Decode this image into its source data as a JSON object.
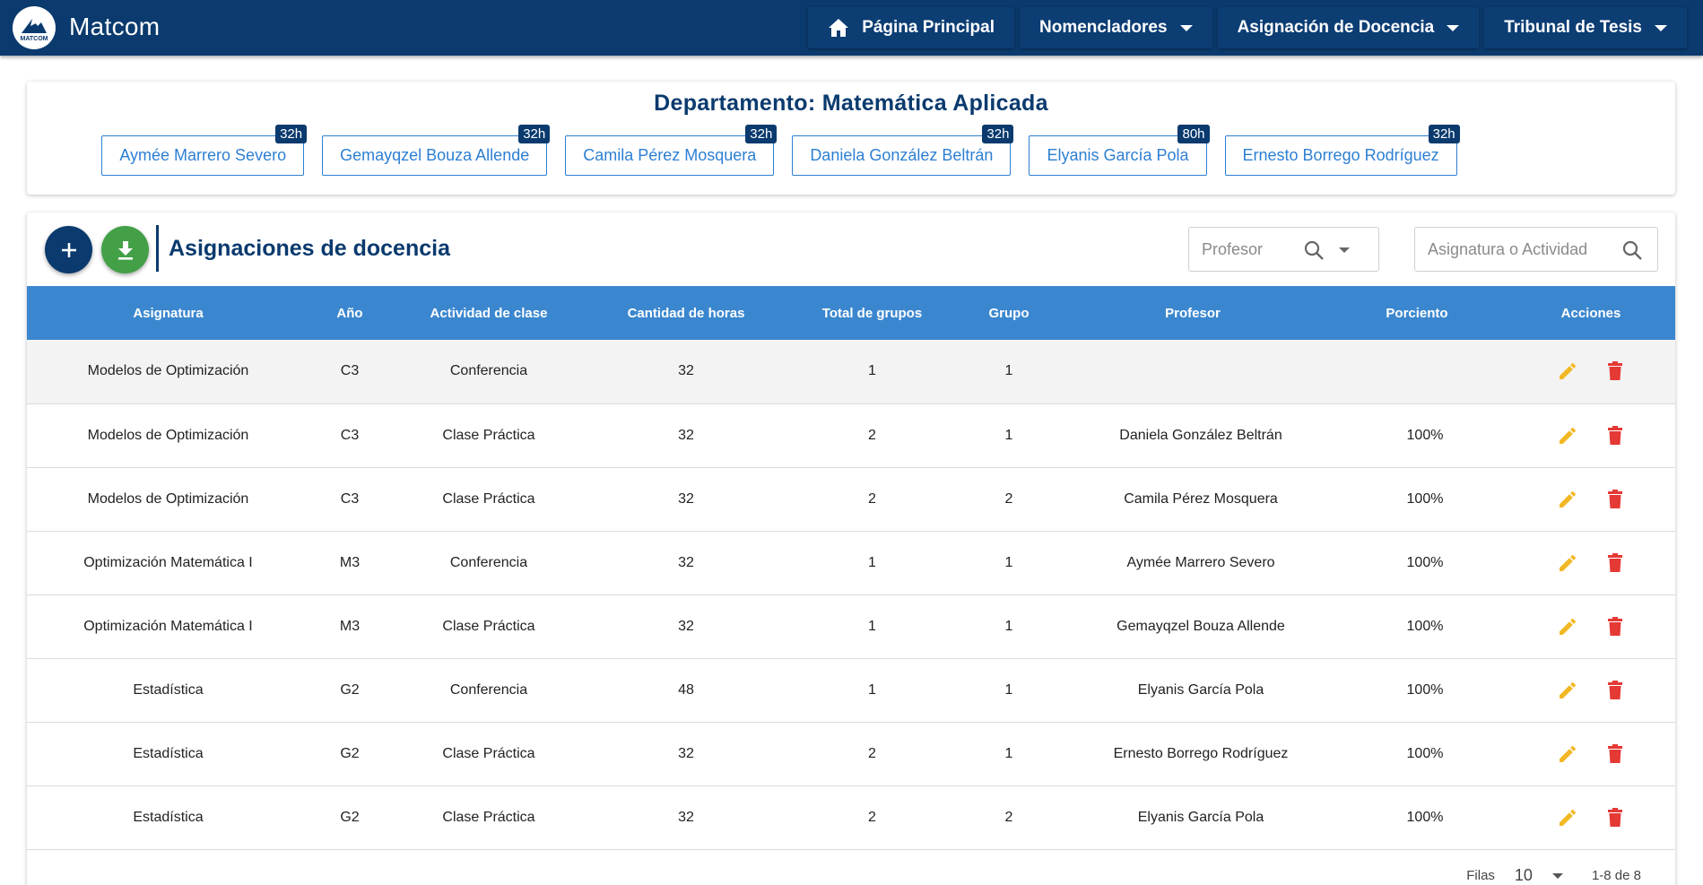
{
  "app": {
    "name": "Matcom",
    "logo_text": "MATCOM"
  },
  "nav": [
    {
      "label": "Página Principal",
      "icon": "home-icon",
      "dropdown": false
    },
    {
      "label": "Nomencladores",
      "dropdown": true
    },
    {
      "label": "Asignación de Docencia",
      "dropdown": true
    },
    {
      "label": "Tribunal de Tesis",
      "dropdown": true
    }
  ],
  "department": {
    "title": "Departamento: Matemática Aplicada",
    "professors": [
      {
        "name": "Aymée Marrero Severo",
        "hours": "32h"
      },
      {
        "name": "Gemayqzel Bouza Allende",
        "hours": "32h"
      },
      {
        "name": "Camila Pérez Mosquera",
        "hours": "32h"
      },
      {
        "name": "Daniela González Beltrán",
        "hours": "32h"
      },
      {
        "name": "Elyanis García Pola",
        "hours": "80h"
      },
      {
        "name": "Ernesto Borrego Rodríguez",
        "hours": "32h"
      }
    ]
  },
  "assignments": {
    "title": "Asignaciones de docencia",
    "filters": {
      "profesor_placeholder": "Profesor",
      "asignatura_placeholder": "Asignatura o Actividad"
    },
    "columns": [
      "Asignatura",
      "Año",
      "Actividad de clase",
      "Cantidad de horas",
      "Total de grupos",
      "Grupo",
      "Profesor",
      "Porciento",
      "Acciones"
    ],
    "rows": [
      [
        "Modelos de Optimización",
        "C3",
        "Conferencia",
        "32",
        "1",
        "1",
        "",
        ""
      ],
      [
        "Modelos de Optimización",
        "C3",
        "Clase Práctica",
        "32",
        "2",
        "1",
        "Daniela González Beltrán",
        "100%"
      ],
      [
        "Modelos de Optimización",
        "C3",
        "Clase Práctica",
        "32",
        "2",
        "2",
        "Camila Pérez Mosquera",
        "100%"
      ],
      [
        "Optimización Matemática I",
        "M3",
        "Conferencia",
        "32",
        "1",
        "1",
        "Aymée Marrero Severo",
        "100%"
      ],
      [
        "Optimización Matemática I",
        "M3",
        "Clase Práctica",
        "32",
        "1",
        "1",
        "Gemayqzel Bouza Allende",
        "100%"
      ],
      [
        "Estadística",
        "G2",
        "Conferencia",
        "48",
        "1",
        "1",
        "Elyanis García Pola",
        "100%"
      ],
      [
        "Estadística",
        "G2",
        "Clase Práctica",
        "32",
        "2",
        "1",
        "Ernesto Borrego Rodríguez",
        "100%"
      ],
      [
        "Estadística",
        "G2",
        "Clase Práctica",
        "32",
        "2",
        "2",
        "Elyanis García Pola",
        "100%"
      ]
    ],
    "pagination": {
      "rows_label": "Filas",
      "rows_value": "10",
      "range": "1-8 de 8"
    }
  },
  "colors": {
    "primary": "#0a3a6e",
    "header_row": "#3b87cf",
    "chip": "#2d7fd3",
    "download": "#43a047",
    "edit": "#f2b824",
    "delete": "#e53935"
  }
}
